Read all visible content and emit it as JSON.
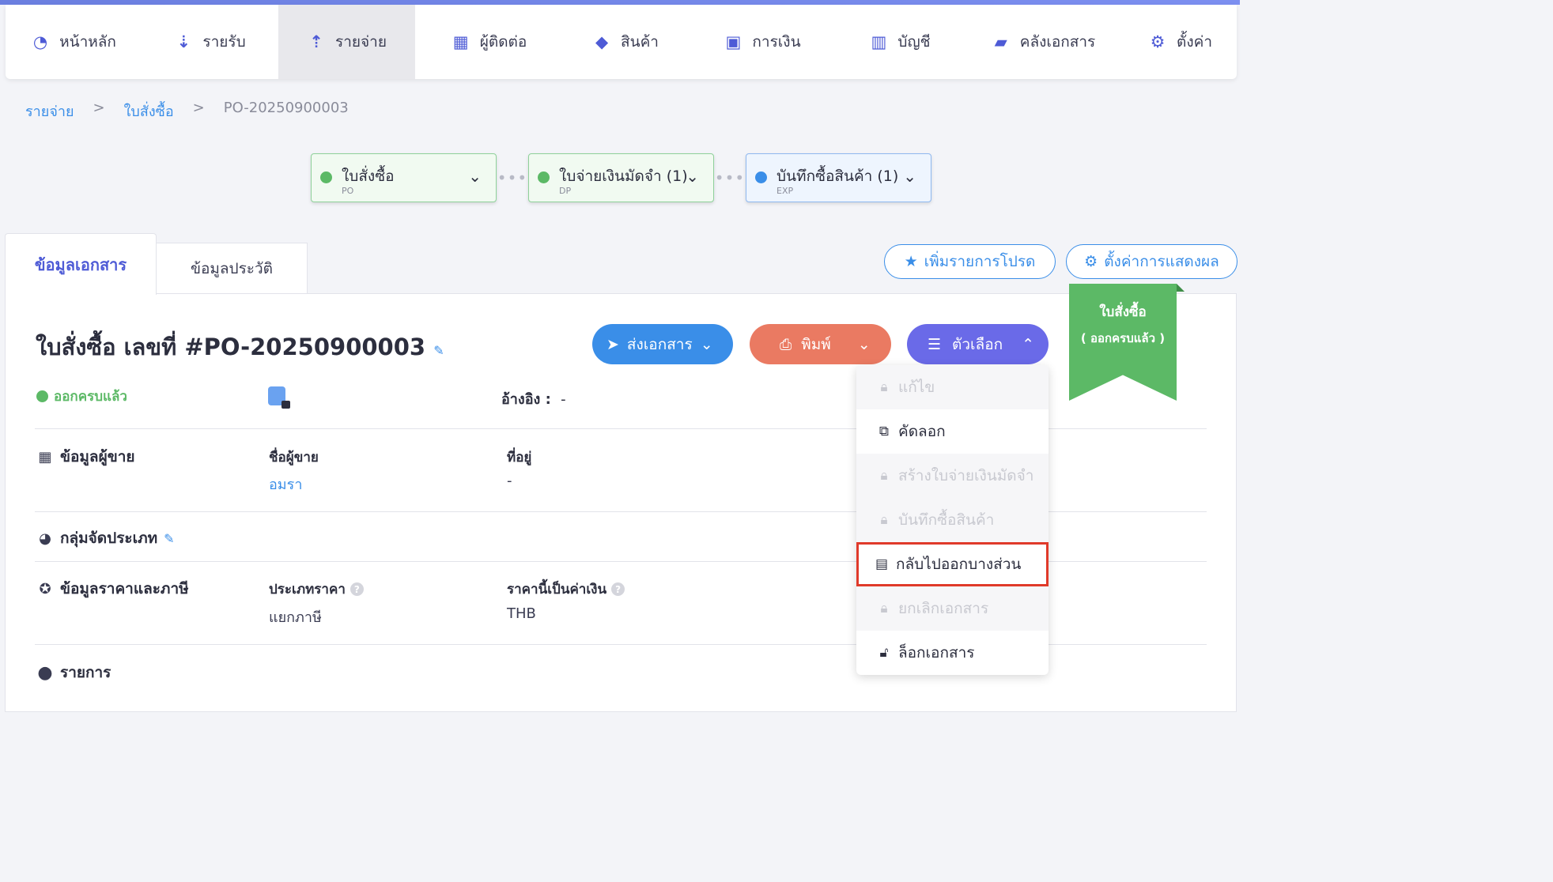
{
  "nav": {
    "items": [
      {
        "label": "หน้าหลัก",
        "icon": "dashboard-icon"
      },
      {
        "label": "รายรับ",
        "icon": "income-icon"
      },
      {
        "label": "รายจ่าย",
        "icon": "expense-icon",
        "active": true
      },
      {
        "label": "ผู้ติดต่อ",
        "icon": "contacts-icon"
      },
      {
        "label": "สินค้า",
        "icon": "product-box-icon"
      },
      {
        "label": "การเงิน",
        "icon": "money-icon"
      },
      {
        "label": "บัญชี",
        "icon": "ledger-icon"
      },
      {
        "label": "คลังเอกสาร",
        "icon": "folder-icon"
      },
      {
        "label": "ตั้งค่า",
        "icon": "gear-icon"
      }
    ]
  },
  "breadcrumb": {
    "items": [
      "รายจ่าย",
      "ใบสั่งซื้อ",
      "PO-20250900003"
    ],
    "separator": ">"
  },
  "flow": {
    "chips": [
      {
        "title": "ใบสั่งซื้อ",
        "code": "PO",
        "color": "#5cb966"
      },
      {
        "title": "ใบจ่ายเงินมัดจำ (1)",
        "code": "DP",
        "color": "#5cb966"
      },
      {
        "title": "บันทึกซื้อสินค้า (1)",
        "code": "EXP",
        "color": "#3a8ee8"
      }
    ],
    "connector": "•••"
  },
  "tabs": [
    "ข้อมูลเอกสาร",
    "ข้อมูลประวัติ"
  ],
  "top_buttons": {
    "favorite": "เพิ่มรายการโปรด",
    "display_settings": "ตั้งค่าการแสดงผล"
  },
  "document": {
    "title": "ใบสั่งซื้อ เลขที่ #PO-20250900003",
    "status": "ออกครบแล้ว",
    "reference_label": "อ้างอิง :",
    "reference_value": "-"
  },
  "actions": {
    "send": "ส่งเอกสาร",
    "print": "พิมพ์",
    "options": "ตัวเลือก"
  },
  "ribbon": {
    "line1": "ใบสั่งซื้อ",
    "line2": "( ออกครบแล้ว )"
  },
  "vendor_section": {
    "title": "ข้อมูลผู้ขาย",
    "name_label": "ชื่อผู้ขาย",
    "name_value": "อมรา",
    "address_label": "ที่อยู่",
    "address_value": "-"
  },
  "category_section": {
    "title": "กลุ่มจัดประเภท"
  },
  "price_section": {
    "title": "ข้อมูลราคาและภาษี",
    "price_type_label": "ประเภทราคา",
    "price_type_value": "แยกภาษี",
    "currency_label": "ราคานี้เป็นค่าเงิน",
    "currency_value": "THB"
  },
  "items_section": {
    "title": "รายการ"
  },
  "options_menu": [
    {
      "label": "แก้ไข",
      "enabled": false,
      "icon": "lock-icon"
    },
    {
      "label": "คัดลอก",
      "enabled": true,
      "icon": "copy-icon"
    },
    {
      "label": "สร้างใบจ่ายเงินมัดจำ",
      "enabled": false,
      "icon": "lock-icon"
    },
    {
      "label": "บันทึกซื้อสินค้า",
      "enabled": false,
      "icon": "lock-icon"
    },
    {
      "label": "กลับไปออกบางส่วน",
      "enabled": true,
      "icon": "document-icon",
      "highlighted": true
    },
    {
      "label": "ยกเลิกเอกสาร",
      "enabled": false,
      "icon": "lock-icon"
    },
    {
      "label": "ล็อกเอกสาร",
      "enabled": true,
      "icon": "padlock-icon"
    }
  ],
  "colors": {
    "accent": "#4e5bd6",
    "link": "#3a8ee8",
    "success": "#5cb966",
    "print": "#ea7a62",
    "options": "#6a6ae8",
    "highlight_border": "#e03a2a"
  }
}
